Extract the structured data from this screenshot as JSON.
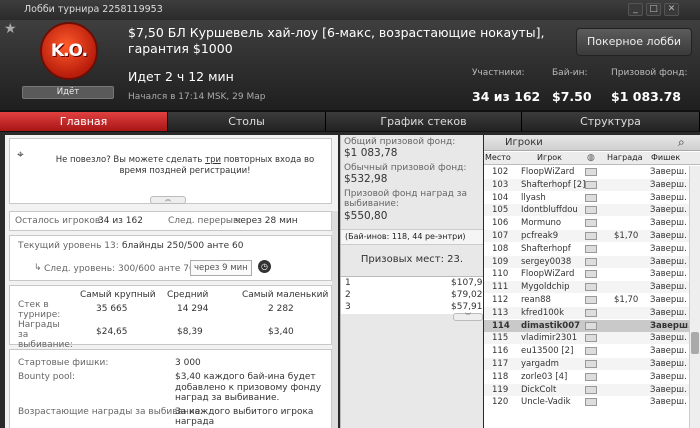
{
  "window": {
    "title": "Лобби турнира 2258119953"
  },
  "header": {
    "logo_text": "K.O.",
    "status_button": "Идёт",
    "title": "$7,50 БЛ Куршевель хай-лоу [6-макс, возрастающие нокауты], гарантия $1000",
    "lobby_button": "Покерное лобби",
    "running": "Идет 2 ч 12 мин",
    "started": "Начался в 17:14 MSK, 29 Мар",
    "stats": [
      {
        "label": "Участники:",
        "value": "34 из 162"
      },
      {
        "label": "Бай-ин:",
        "value": "$7.50"
      },
      {
        "label": "Призовой фонд:",
        "value": "$1 083.78"
      }
    ]
  },
  "tabs": [
    "Главная",
    "Столы",
    "График стеков",
    "Структура"
  ],
  "left": {
    "rebuy_pre": "Не повезло? Вы можете сделать",
    "rebuy_link": "три",
    "rebuy_post": "повторных входа во время поздней регистрации!",
    "remaining_label": "Осталось игроков:",
    "remaining_value": "34 из 162",
    "break_label": "След. перерыв:",
    "break_value": "через 28 мин",
    "level_label": "Текущий уровень 13:",
    "level_value": "блайнды 250/500 анте 60",
    "next_label": "След. уровень:",
    "next_value": "300/600 анте 70",
    "next_in": "через 9 мин",
    "stacks": {
      "cols": [
        "Самый крупный",
        "Средний",
        "Самый маленький"
      ],
      "rows": [
        {
          "label": "Стек в турнире:",
          "values": [
            "35 665",
            "14 294",
            "2 282"
          ]
        },
        {
          "label": "Награды за выбивание:",
          "values": [
            "$24,65",
            "$8,39",
            "$3,40"
          ]
        }
      ]
    },
    "start_chips_label": "Стартовые фишки:",
    "start_chips_value": "3 000",
    "bounty_label": "Bounty pool:",
    "bounty_value": "$3,40 каждого бай-ина будет добавлено к призовому фонду наград за выбивание.",
    "prog_label": "Возрастающие награды за выбивание:",
    "prog_value": "За каждого выбитого игрока награда"
  },
  "mid": {
    "total_label": "Общий призовой фонд:",
    "total_value": "$1 083,78",
    "regular_label": "Обычный призовой фонд:",
    "regular_value": "$532,98",
    "bounty_label": "Призовой фонд наград за выбивание:",
    "bounty_value": "$550,80",
    "buyins": "(Бай-инов: 118, 44 ре-энтри)",
    "places": "Призовых мест: 23.",
    "prizes": [
      {
        "place": "1",
        "amount": "$107,93"
      },
      {
        "place": "2",
        "amount": "$79,02"
      },
      {
        "place": "3",
        "amount": "$57,91"
      }
    ]
  },
  "players": {
    "title": "Игроки",
    "cols": [
      "Место",
      "Игрок",
      "",
      "Награда",
      "Фишек"
    ],
    "rows": [
      {
        "place": "102",
        "name": "FloopWiZard",
        "prize": "",
        "chips": "Заверш."
      },
      {
        "place": "103",
        "name": "Shafterhopf [2]",
        "prize": "",
        "chips": "Заверш."
      },
      {
        "place": "104",
        "name": "llyash",
        "prize": "",
        "chips": "Заверш."
      },
      {
        "place": "105",
        "name": "Idontbluffdou",
        "prize": "",
        "chips": "Заверш."
      },
      {
        "place": "106",
        "name": "Mormuno",
        "prize": "",
        "chips": "Заверш."
      },
      {
        "place": "107",
        "name": "pcfreak9",
        "prize": "$1,70",
        "chips": "Заверш."
      },
      {
        "place": "108",
        "name": "Shafterhopf",
        "prize": "",
        "chips": "Заверш."
      },
      {
        "place": "109",
        "name": "sergey0038",
        "prize": "",
        "chips": "Заверш."
      },
      {
        "place": "110",
        "name": "FloopWiZard",
        "prize": "",
        "chips": "Заверш."
      },
      {
        "place": "111",
        "name": "Mygoldchip",
        "prize": "",
        "chips": "Заверш."
      },
      {
        "place": "112",
        "name": "rean88",
        "prize": "$1,70",
        "chips": "Заверш."
      },
      {
        "place": "113",
        "name": "kfred100k",
        "prize": "",
        "chips": "Заверш."
      },
      {
        "place": "114",
        "name": "dimastik007",
        "prize": "",
        "chips": "Заверш."
      },
      {
        "place": "115",
        "name": "vladimir2301",
        "prize": "",
        "chips": "Заверш."
      },
      {
        "place": "116",
        "name": "eu13500 [2]",
        "prize": "",
        "chips": "Заверш."
      },
      {
        "place": "117",
        "name": "yargadm",
        "prize": "",
        "chips": "Заверш."
      },
      {
        "place": "118",
        "name": "zorle03 [4]",
        "prize": "",
        "chips": "Заверш."
      },
      {
        "place": "119",
        "name": "DickColt",
        "prize": "",
        "chips": "Заверш."
      },
      {
        "place": "120",
        "name": "Uncle-Vadik",
        "prize": "",
        "chips": "Заверш."
      }
    ]
  }
}
